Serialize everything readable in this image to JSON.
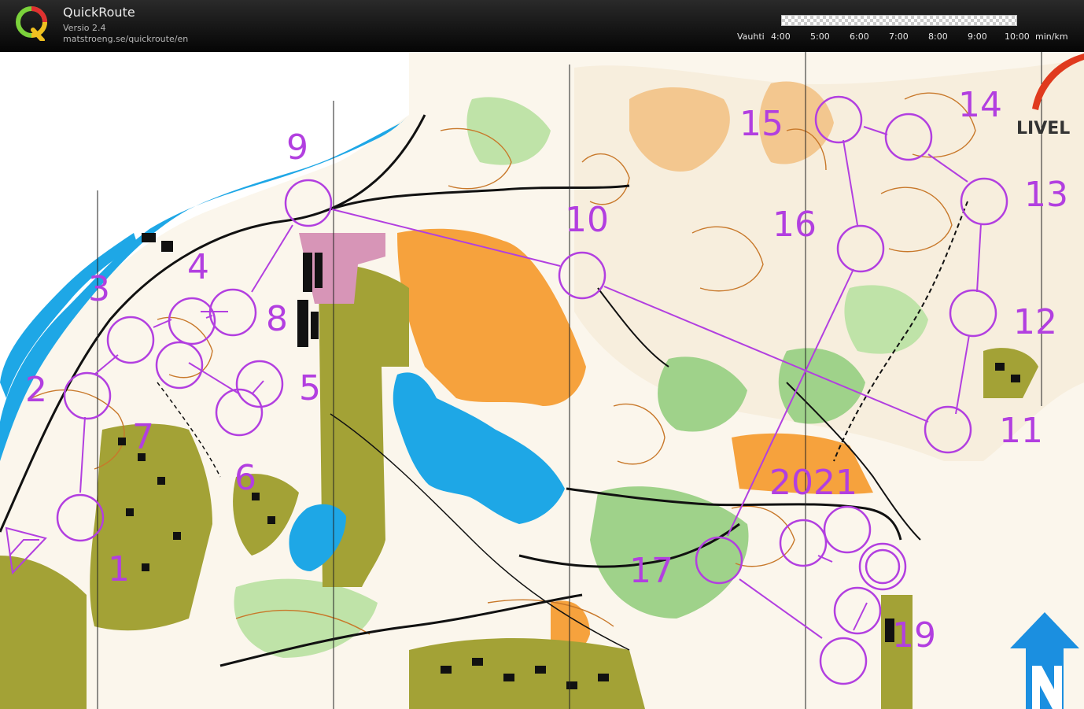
{
  "app": {
    "title": "QuickRoute",
    "version": "Versio 2.4",
    "url": "matstroeng.se/quickroute/en",
    "logo_letter": "Q"
  },
  "pace_scale": {
    "label": "Vauhti",
    "ticks": [
      "4:00",
      "5:00",
      "6:00",
      "7:00",
      "8:00",
      "9:00",
      "10:00"
    ],
    "unit": "min/km"
  },
  "map": {
    "course_color": "#b23fe0",
    "control_labels": [
      "1",
      "2",
      "3",
      "4",
      "5",
      "6",
      "7",
      "8",
      "9",
      "10",
      "11",
      "12",
      "13",
      "14",
      "15",
      "16",
      "17",
      "19",
      "2021"
    ],
    "brand_text": "LIVEL",
    "north_arrow": "north-arrow-icon"
  }
}
